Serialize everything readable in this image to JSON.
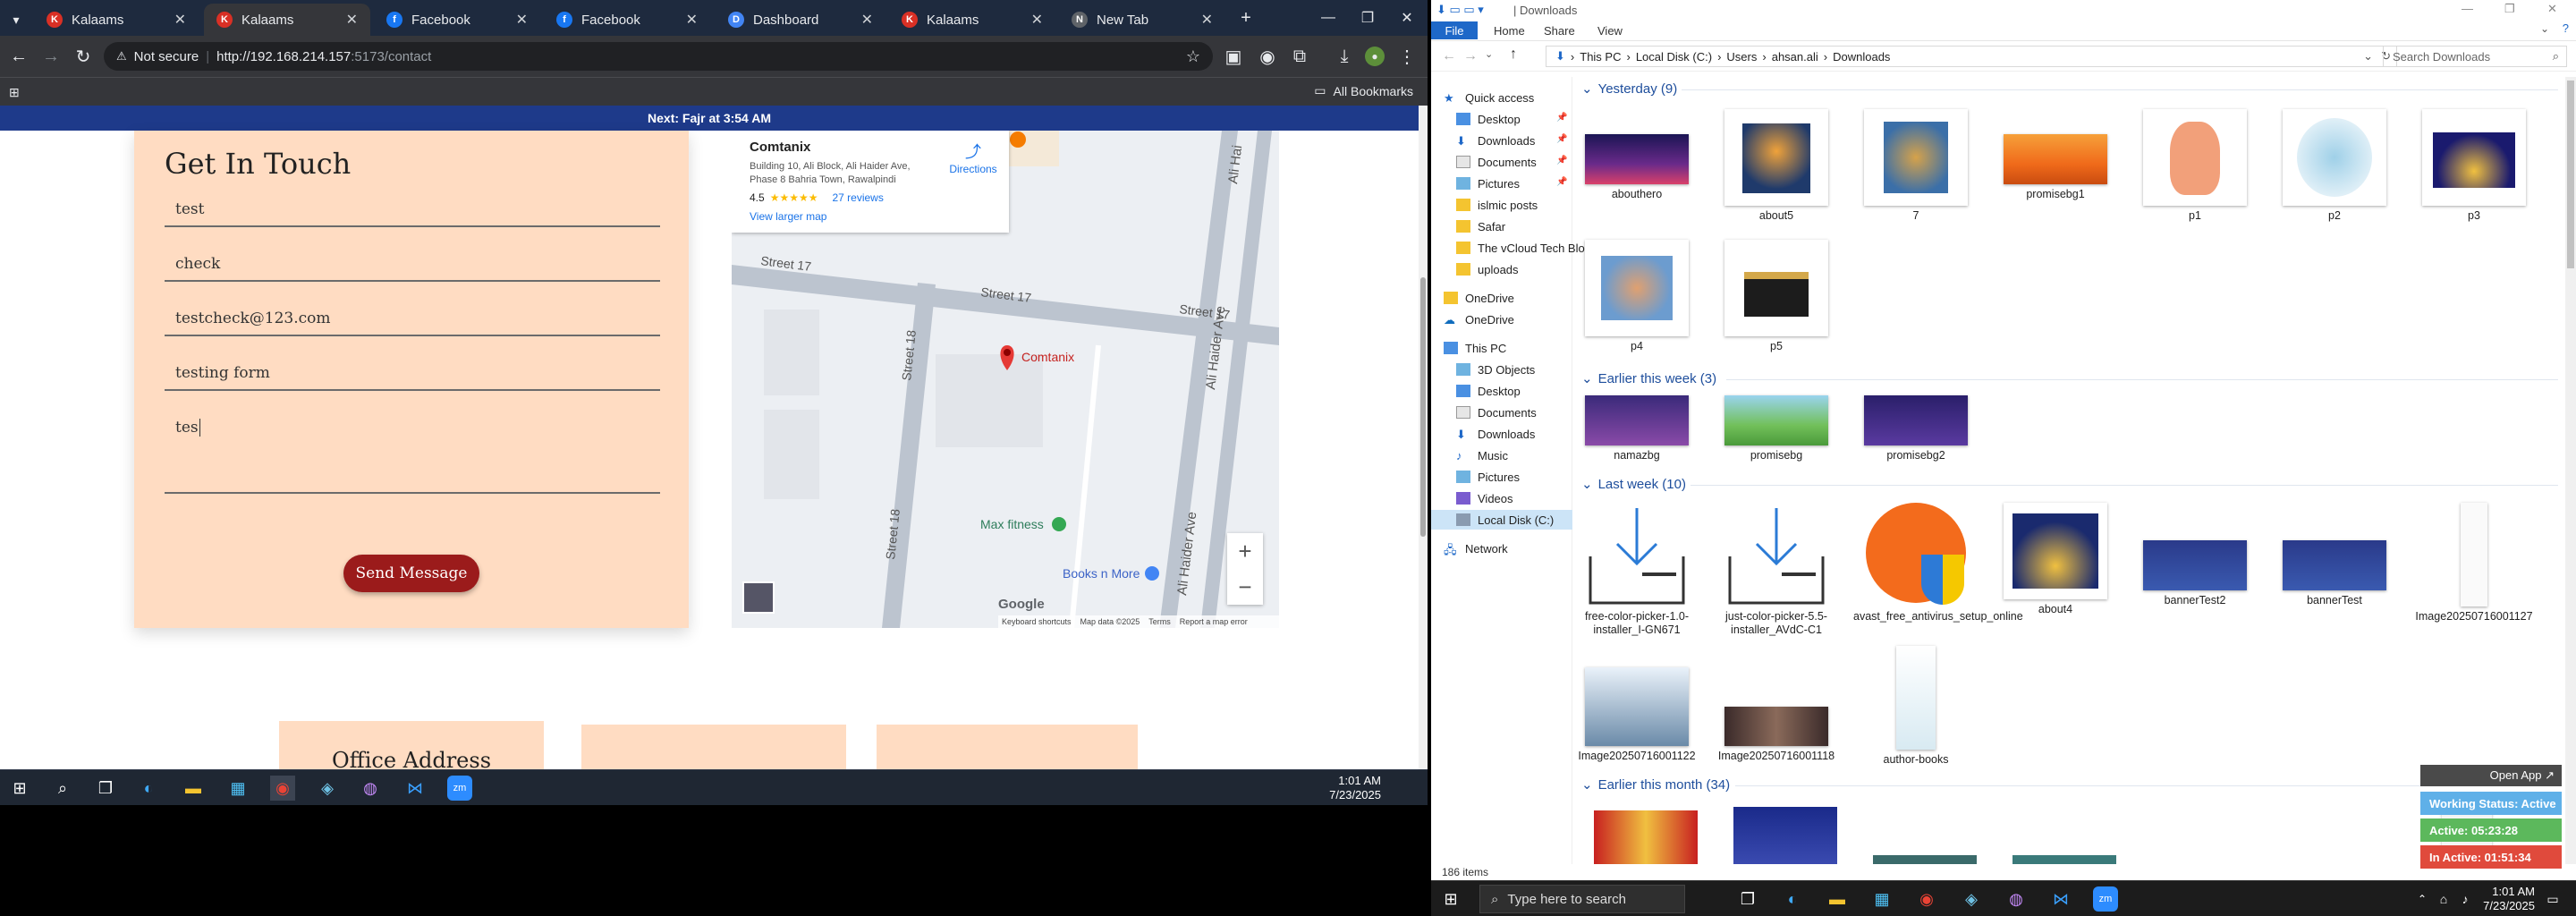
{
  "browser": {
    "tabs": [
      {
        "title": "Kalaams",
        "fav": "K",
        "color": "#d93025"
      },
      {
        "title": "Kalaams",
        "fav": "K",
        "color": "#d93025"
      },
      {
        "title": "Facebook",
        "fav": "f",
        "color": "#1877f2"
      },
      {
        "title": "Facebook",
        "fav": "f",
        "color": "#1877f2"
      },
      {
        "title": "Dashboard",
        "fav": "D",
        "color": "#4285f4"
      },
      {
        "title": "Kalaams",
        "fav": "K",
        "color": "#d93025"
      },
      {
        "title": "New Tab",
        "fav": "N",
        "color": "#5f6368"
      }
    ],
    "address": {
      "security": "Not secure",
      "host": "http://192.168.214.157",
      "rest": ":5173/contact"
    },
    "bookmarks_label": "All Bookmarks"
  },
  "page": {
    "banner": "Next: Fajr at 3:54 AM",
    "form": {
      "title": "Get In Touch",
      "fields": [
        "test",
        "check",
        "testcheck@123.com",
        "testing form",
        "tes"
      ],
      "send_label": "Send Message"
    },
    "map": {
      "place_name": "Comtanix",
      "address_line1": "Building 10, Ali Block, Ali Haider Ave,",
      "address_line2": "Phase 8 Bahria Town, Rawalpindi",
      "rating": "4.5",
      "stars": "★★★★★",
      "reviews": "27 reviews",
      "larger_map": "View larger map",
      "directions": "Directions",
      "pin_label": "Comtanix",
      "streets": {
        "s17a": "Street 17",
        "s17b": "Street 17",
        "s17c": "Street 17",
        "s18a": "Street 18",
        "s18b": "Street 18",
        "ali1": "Ali Haider Ave",
        "ali2": "Ali Haider Ave",
        "ali3": "Ali Hai"
      },
      "pois": {
        "fitness": "Max fitness",
        "books": "Books n More"
      },
      "zoom_in": "+",
      "zoom_out": "−",
      "logo": "Google",
      "footer": [
        "Keyboard shortcuts",
        "Map data ©2025",
        "Terms",
        "Report a map error"
      ]
    },
    "lower": {
      "office_heading": "Office Address"
    }
  },
  "taskbar_left": {
    "time": "1:01 AM",
    "date": "7/23/2025"
  },
  "explorer": {
    "title": "Downloads",
    "ribbon_tabs": [
      "File",
      "Home",
      "Share",
      "View"
    ],
    "breadcrumb": [
      "This PC",
      "Local Disk (C:)",
      "Users",
      "ahsan.ali",
      "Downloads"
    ],
    "search_placeholder": "Search Downloads",
    "nav": {
      "quick_access": "Quick access",
      "pinned": [
        "Desktop",
        "Downloads",
        "Documents",
        "Pictures"
      ],
      "folders": [
        "islmic posts",
        "Safar",
        "The vCloud Tech Blo",
        "uploads"
      ],
      "onedrive1": "OneDrive",
      "onedrive2": "OneDrive",
      "this_pc": "This PC",
      "pc_items": [
        "3D Objects",
        "Desktop",
        "Documents",
        "Downloads",
        "Music",
        "Pictures",
        "Videos",
        "Local Disk (C:)"
      ],
      "network": "Network"
    },
    "groups": {
      "yesterday": "Yesterday (9)",
      "earlier_week": "Earlier this week (3)",
      "last_week": "Last week (10)",
      "earlier_month": "Earlier this month (34)"
    },
    "files_yesterday": [
      "abouthero",
      "about5",
      "7",
      "promisebg1",
      "p1",
      "p2",
      "p3",
      "p4",
      "p5"
    ],
    "files_week": [
      "namazbg",
      "promisebg",
      "promisebg2"
    ],
    "files_lastweek": [
      "free-color-picker-1.0-installer_I-GN671",
      "just-color-picker-5.5-installer_AVdC-C1",
      "avast_free_antivirus_setup_online",
      "about4",
      "bannerTest2",
      "bannerTest",
      "Image20250716001127",
      "Image20250716001122",
      "Image20250716001118",
      "author-books"
    ],
    "status": "186 items"
  },
  "widget": {
    "open_app": "Open App ↗",
    "working": "Working Status: Active",
    "active": "Active: 05:23:28",
    "inactive": "In Active: 01:51:34"
  },
  "taskbar_right": {
    "search_placeholder": "Type here to search",
    "time": "1:01 AM",
    "date": "7/23/2025"
  }
}
